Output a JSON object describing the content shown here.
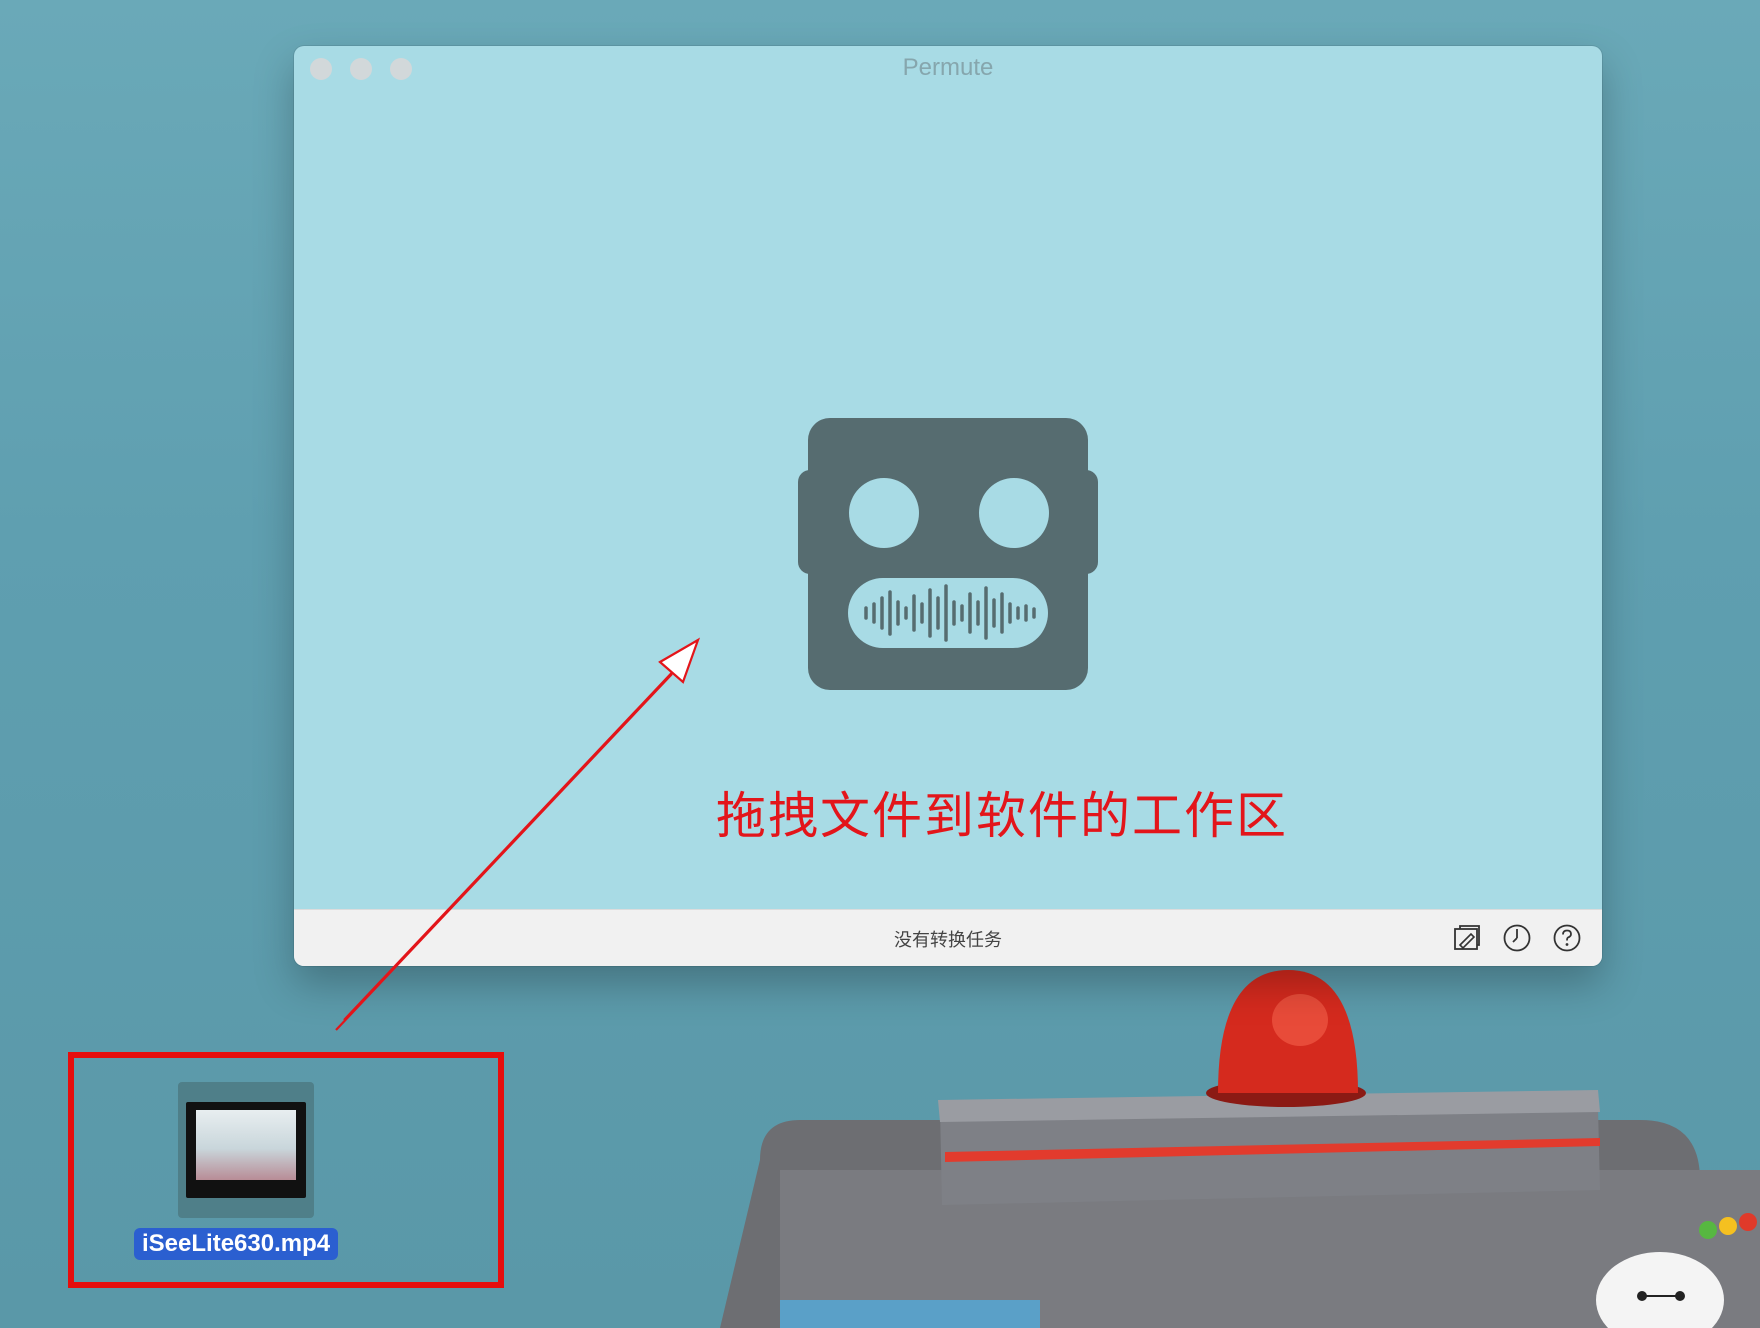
{
  "window": {
    "title": "Permute",
    "status": "没有转换任务",
    "buttons": {
      "close": "close-button",
      "minimize": "minimize-button",
      "zoom": "zoom-button"
    },
    "toolbar_icons": [
      "presets-icon",
      "history-clock-icon",
      "help-icon"
    ]
  },
  "annotation": {
    "text": "拖拽文件到软件的工作区",
    "color": "#e3151a"
  },
  "desktop_file": {
    "name": "iSeeLite630.mp4"
  },
  "colors": {
    "window_bg": "#a8dbe5",
    "robot": "#566c70",
    "selection": "#2b5fd0",
    "highlight": "#e60d0d"
  }
}
